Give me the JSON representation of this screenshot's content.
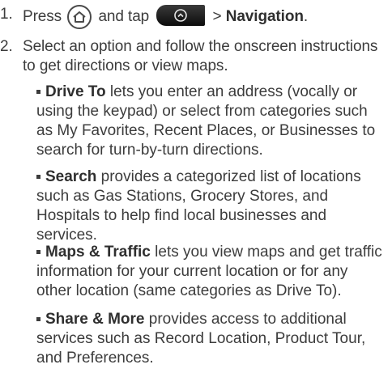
{
  "steps": [
    {
      "number": "1.",
      "text_press": "Press",
      "text_and_tap": "and tap",
      "text_gt": ">",
      "text_target": "Navigation",
      "text_end": "."
    },
    {
      "number": "2.",
      "text": "Select an option and follow the onscreen instructions to get directions or view maps."
    }
  ],
  "options": [
    {
      "name": "Drive To",
      "description": "lets you enter an address (vocally or using the keypad) or select from categories such as My Favorites, Recent Places, or Businesses to search for turn-by-turn directions."
    },
    {
      "name": "Search",
      "description": "provides a categorized list of locations such as Gas Stations, Grocery Stores, and Hospitals to help find local businesses and services."
    },
    {
      "name": "Maps & Traffic",
      "description": "lets you view maps and get traffic information for your current location or for any other location (same categories as Drive To)."
    },
    {
      "name": "Share & More",
      "description": "provides access to additional services such as Record Location, Product Tour, and Preferences."
    }
  ],
  "icons": {
    "home_key": "home-key-icon",
    "apps_key": "all-apps-key-icon"
  }
}
